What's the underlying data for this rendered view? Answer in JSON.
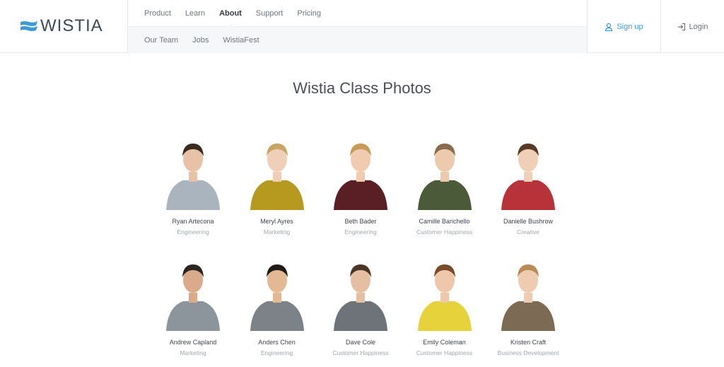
{
  "brand": {
    "name": "WISTIA",
    "color": "#3c9ad7"
  },
  "nav": {
    "primary": [
      "Product",
      "Learn",
      "About",
      "Support",
      "Pricing"
    ],
    "active": "About",
    "secondary": [
      "Our Team",
      "Jobs",
      "WistiaFest"
    ]
  },
  "auth": {
    "signup_label": "Sign up",
    "login_label": "Login"
  },
  "page": {
    "title": "Wistia Class Photos"
  },
  "people": [
    {
      "name": "Ryan Artecona",
      "role": "Engineering",
      "shirt": "#a9b4bf",
      "hair": "#3a2a1e",
      "skin": "#e7c2a6"
    },
    {
      "name": "Meryl Ayres",
      "role": "Marketing",
      "shirt": "#b59a1f",
      "hair": "#c9a463",
      "skin": "#efcfb6"
    },
    {
      "name": "Beth Bader",
      "role": "Engineering",
      "shirt": "#5a1f24",
      "hair": "#c79a55",
      "skin": "#f0cbb0"
    },
    {
      "name": "Camille Barichello",
      "role": "Customer Happiness",
      "shirt": "#4b5b3a",
      "hair": "#8a6a4a",
      "skin": "#edc9ad"
    },
    {
      "name": "Danielle Bushrow",
      "role": "Creative",
      "shirt": "#b8323a",
      "hair": "#5a3a26",
      "skin": "#f0cfb7"
    },
    {
      "name": "Andrew Capland",
      "role": "Marketing",
      "shirt": "#8d959c",
      "hair": "#2b2420",
      "skin": "#d9ab8a"
    },
    {
      "name": "Anders Chen",
      "role": "Engineering",
      "shirt": "#7c8288",
      "hair": "#1e1a18",
      "skin": "#e3b893"
    },
    {
      "name": "Dave Cole",
      "role": "Customer Happiness",
      "shirt": "#6d7378",
      "hair": "#4a3624",
      "skin": "#e6bea2"
    },
    {
      "name": "Emily Coleman",
      "role": "Customer Happiness",
      "shirt": "#e6d23a",
      "hair": "#7a4a2a",
      "skin": "#efc7ab"
    },
    {
      "name": "Kristen Craft",
      "role": "Business Development",
      "shirt": "#7d6a55",
      "hair": "#b98a55",
      "skin": "#efcbb0"
    }
  ]
}
